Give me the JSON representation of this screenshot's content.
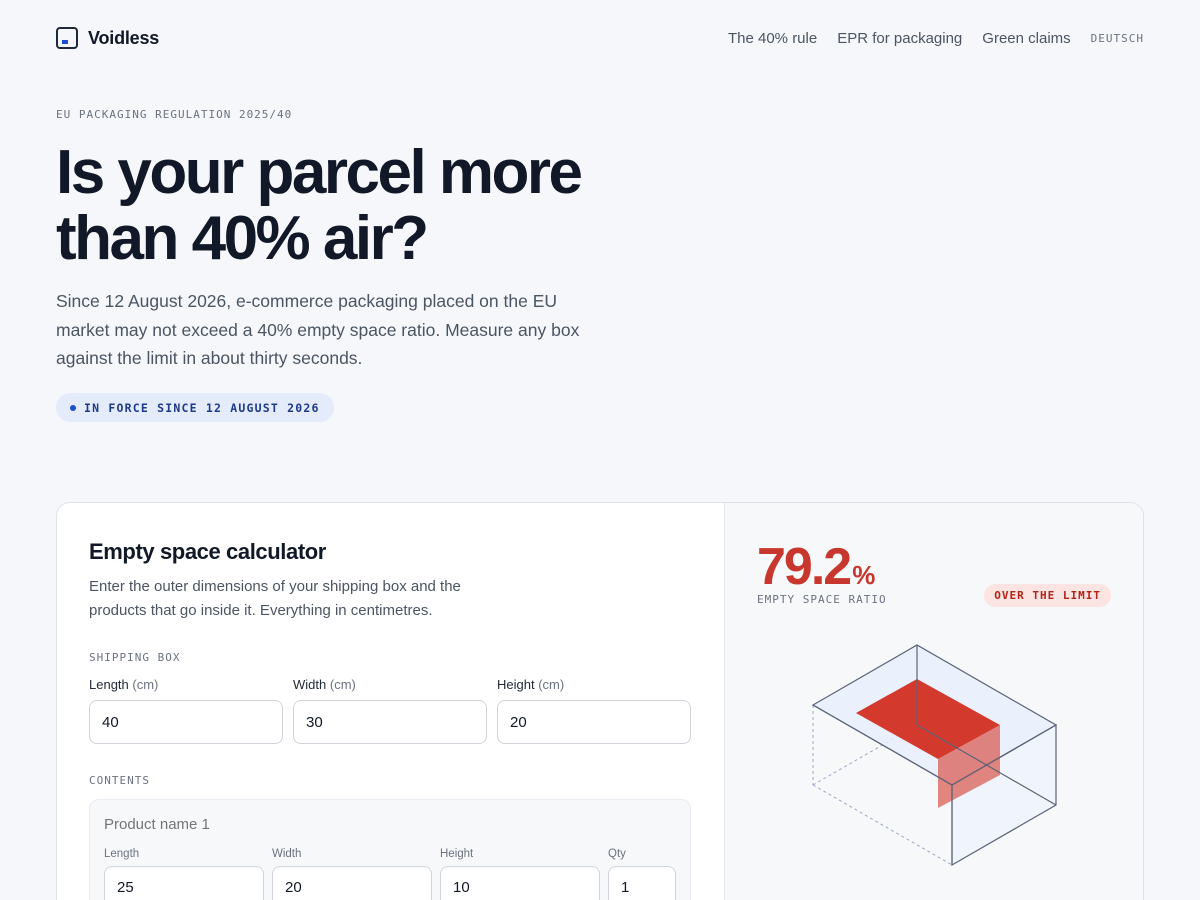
{
  "brand": {
    "name": "Voidless",
    "logo_icon": "box-logo-icon"
  },
  "nav": {
    "items": [
      "The 40% rule",
      "EPR for packaging",
      "Green claims"
    ],
    "language": "DEUTSCH"
  },
  "hero": {
    "eyebrow": "EU PACKAGING REGULATION 2025/40",
    "title": "Is your parcel more than 40% air?",
    "subtitle": "Since 12 August 2026, e-commerce packaging placed on the EU market may not exceed a 40% empty space ratio. Measure any box against the limit in about thirty seconds.",
    "pill": "IN FORCE SINCE 12 AUGUST 2026"
  },
  "calculator": {
    "title": "Empty space calculator",
    "description": "Enter the outer dimensions of your shipping box and the products that go inside it. Everything in centimetres.",
    "box_label": "SHIPPING BOX",
    "box_fields": [
      {
        "label": "Length",
        "unit": "(cm)",
        "value": "40"
      },
      {
        "label": "Width",
        "unit": "(cm)",
        "value": "30"
      },
      {
        "label": "Height",
        "unit": "(cm)",
        "value": "20"
      }
    ],
    "contents_label": "CONTENTS",
    "product": {
      "name_placeholder": "Product name 1",
      "length_label": "Length",
      "length_value": "25",
      "width_label": "Width",
      "width_value": "20",
      "height_label": "Height",
      "height_value": "10",
      "qty_label": "Qty",
      "qty_value": "1"
    }
  },
  "result": {
    "ratio_value": "79.2",
    "ratio_unit": "%",
    "ratio_label": "EMPTY SPACE RATIO",
    "status": "OVER THE LIMIT",
    "colors": {
      "over": "#c8372d",
      "accent": "#1d4ed8"
    }
  }
}
